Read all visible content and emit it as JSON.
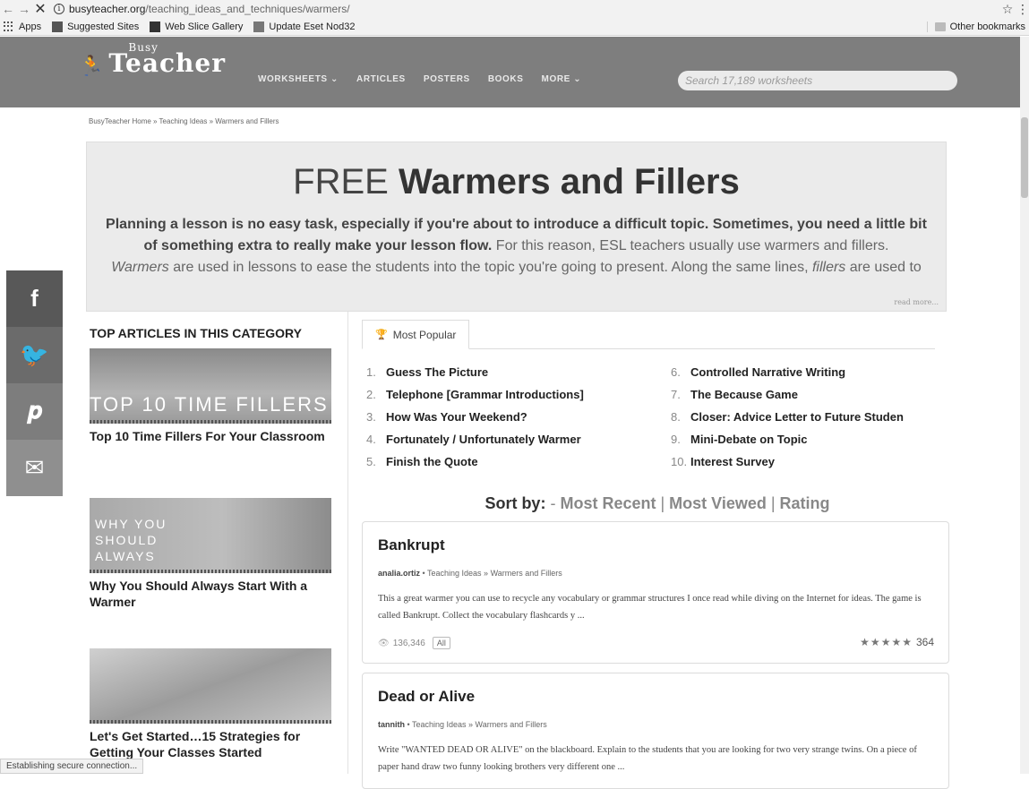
{
  "browser": {
    "url_host": "busyteacher.org",
    "url_path": "/teaching_ideas_and_techniques/warmers/",
    "bookmarks": [
      "Apps",
      "Suggested Sites",
      "Web Slice Gallery",
      "Update Eset Nod32"
    ],
    "other_bookmarks": "Other bookmarks",
    "status": "Establishing secure connection..."
  },
  "site": {
    "logo_small": "Busy",
    "logo_main": "Teacher",
    "nav": [
      "WORKSHEETS ⌄",
      "ARTICLES",
      "POSTERS",
      "BOOKS",
      "MORE ⌄"
    ],
    "search_placeholder": "Search 17,189 worksheets"
  },
  "breadcrumb": "BusyTeacher Home » Teaching Ideas » Warmers and Fillers",
  "hero": {
    "title_light": "FREE ",
    "title_bold": "Warmers and Fillers",
    "intro_bold": "Planning a lesson is no easy task, especially if you're about to introduce a difficult topic. Sometimes, you need a little bit of something extra to really make your lesson flow.",
    "intro_rest": " For this reason, ESL teachers usually use warmers and fillers.",
    "line3_italic_a": "Warmers",
    "line3_mid": " are used in lessons to ease the students into the topic you're going to present. Along the same lines, ",
    "line3_italic_b": "fillers",
    "line3_end": " are used to",
    "read_more": "read more..."
  },
  "left": {
    "category_title": "TOP ARTICLES IN THIS CATEGORY",
    "articles": [
      {
        "image_caption": "TOP 10 TIME FILLERS",
        "title": "Top 10 Time Fillers For Your Classroom"
      },
      {
        "image_caption": "WHY YOU SHOULD ALWAYS",
        "title": "Why You Should Always Start With a Warmer"
      },
      {
        "image_caption": "",
        "title": "Let's Get Started…15 Strategies for Getting Your Classes Started"
      }
    ]
  },
  "tabs": {
    "most_popular": "Most Popular"
  },
  "popular": [
    {
      "n": "1.",
      "title": "Guess The Picture"
    },
    {
      "n": "2.",
      "title": "Telephone [Grammar Introductions]"
    },
    {
      "n": "3.",
      "title": "How Was Your Weekend?"
    },
    {
      "n": "4.",
      "title": "Fortunately / Unfortunately Warmer"
    },
    {
      "n": "5.",
      "title": "Finish the Quote"
    },
    {
      "n": "6.",
      "title": "Controlled Narrative Writing"
    },
    {
      "n": "7.",
      "title": "The Because Game"
    },
    {
      "n": "8.",
      "title": "Closer: Advice Letter to Future Studen"
    },
    {
      "n": "9.",
      "title": "Mini-Debate on Topic"
    },
    {
      "n": "10.",
      "title": "Interest Survey"
    }
  ],
  "sort": {
    "label": "Sort by:",
    "dash": " - ",
    "most_recent": "Most Recent",
    "sep": " | ",
    "most_viewed": "Most Viewed",
    "rating": "Rating"
  },
  "entries": [
    {
      "title": "Bankrupt",
      "author": "analia.ortiz",
      "path": "Teaching Ideas » Warmers and Fillers",
      "desc": "This a great warmer you can use to recycle any vocabulary or grammar structures I once read while diving on the Internet for ideas. The game is called Bankrupt. Collect the vocabulary flashcards y ...",
      "views": "136,346",
      "tag": "All",
      "stars": "★★★★★",
      "rating_count": "364"
    },
    {
      "title": "Dead or Alive",
      "author": "tannith",
      "path": "Teaching Ideas » Warmers and Fillers",
      "desc": "Write \"WANTED DEAD OR ALIVE\" on the blackboard. Explain to the students that you are looking for two very strange twins. On a piece of paper hand draw two funny looking brothers very different one ..."
    }
  ]
}
